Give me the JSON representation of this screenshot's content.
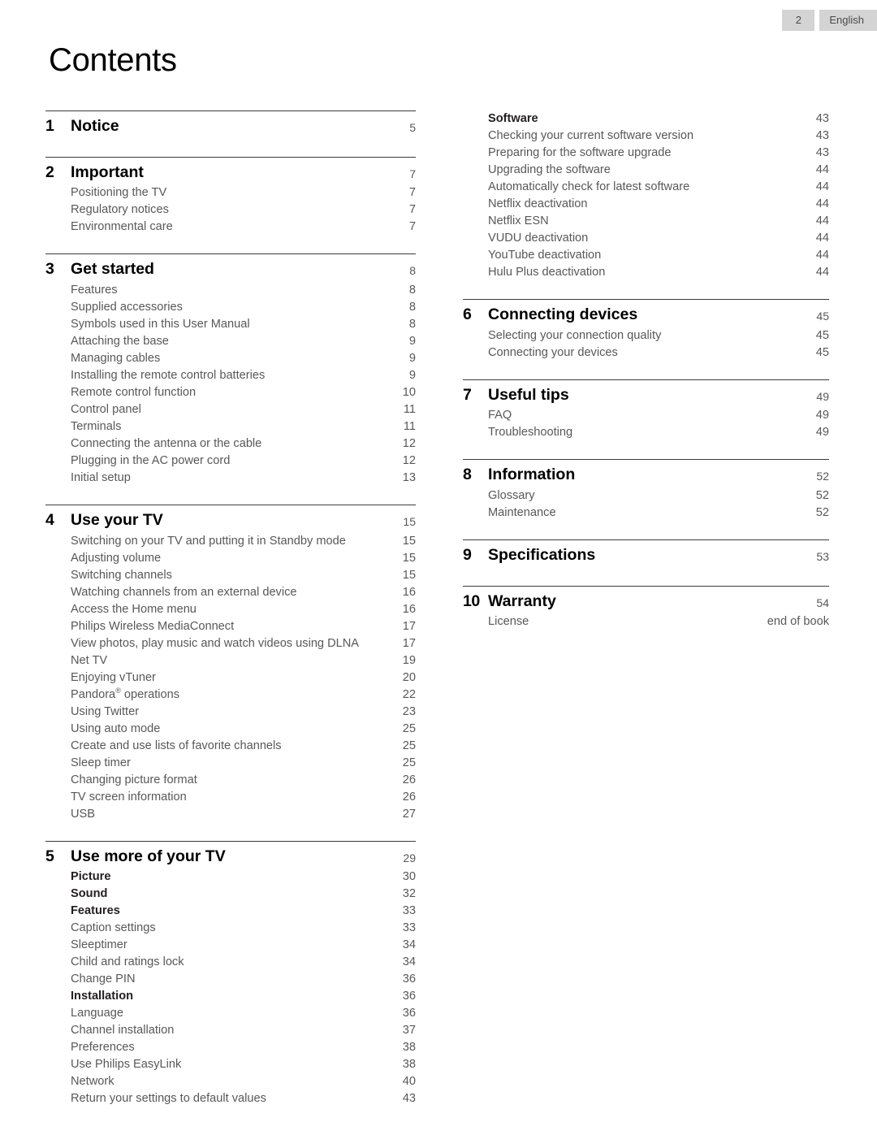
{
  "header": {
    "page_number": "2",
    "language": "English"
  },
  "title": "Contents",
  "columns": {
    "left": [
      {
        "number": "1",
        "label": "Notice",
        "page": "5",
        "items": []
      },
      {
        "number": "2",
        "label": "Important",
        "page": "7",
        "items": [
          {
            "label": "Positioning the TV",
            "page": "7",
            "bold": false
          },
          {
            "label": "Regulatory notices",
            "page": "7",
            "bold": false
          },
          {
            "label": "Environmental care",
            "page": "7",
            "bold": false
          }
        ]
      },
      {
        "number": "3",
        "label": "Get started",
        "page": "8",
        "items": [
          {
            "label": "Features",
            "page": "8",
            "bold": false
          },
          {
            "label": "Supplied accessories",
            "page": "8",
            "bold": false
          },
          {
            "label": "Symbols used in this User Manual",
            "page": "8",
            "bold": false
          },
          {
            "label": "Attaching the base",
            "page": "9",
            "bold": false
          },
          {
            "label": "Managing cables",
            "page": "9",
            "bold": false
          },
          {
            "label": "Installing the remote control batteries",
            "page": "9",
            "bold": false
          },
          {
            "label": "Remote control function",
            "page": "10",
            "bold": false
          },
          {
            "label": "Control panel",
            "page": "11",
            "bold": false
          },
          {
            "label": "Terminals",
            "page": "11",
            "bold": false
          },
          {
            "label": "Connecting the antenna or the cable",
            "page": "12",
            "bold": false
          },
          {
            "label": "Plugging in the AC power cord",
            "page": "12",
            "bold": false
          },
          {
            "label": "Initial setup",
            "page": "13",
            "bold": false
          }
        ]
      },
      {
        "number": "4",
        "label": "Use your TV",
        "page": "15",
        "items": [
          {
            "label": "Switching on your TV and putting it in Standby mode",
            "page": "15",
            "bold": false
          },
          {
            "label": "Adjusting volume",
            "page": "15",
            "bold": false
          },
          {
            "label": "Switching channels",
            "page": "15",
            "bold": false
          },
          {
            "label": "Watching channels from an external device",
            "page": "16",
            "bold": false
          },
          {
            "label": "Access the Home menu",
            "page": "16",
            "bold": false
          },
          {
            "label": "Philips Wireless MediaConnect",
            "page": "17",
            "bold": false
          },
          {
            "label": "View photos, play music and watch videos using DLNA",
            "page": "17",
            "bold": false
          },
          {
            "label": "Net TV",
            "page": "19",
            "bold": false
          },
          {
            "label": "Enjoying vTuner",
            "page": "20",
            "bold": false
          },
          {
            "label": "Pandora® operations",
            "page": "22",
            "bold": false,
            "sup": "®"
          },
          {
            "label": "Using Twitter",
            "page": "23",
            "bold": false
          },
          {
            "label": "Using auto mode",
            "page": "25",
            "bold": false
          },
          {
            "label": "Create and use lists of favorite channels",
            "page": "25",
            "bold": false
          },
          {
            "label": "Sleep timer",
            "page": "25",
            "bold": false
          },
          {
            "label": "Changing picture format",
            "page": "26",
            "bold": false
          },
          {
            "label": "TV screen information",
            "page": "26",
            "bold": false
          },
          {
            "label": "USB",
            "page": "27",
            "bold": false
          }
        ]
      },
      {
        "number": "5",
        "label": "Use more of your TV",
        "page": "29",
        "items": [
          {
            "label": "Picture",
            "page": "30",
            "bold": true
          },
          {
            "label": "Sound",
            "page": "32",
            "bold": true
          },
          {
            "label": "Features",
            "page": "33",
            "bold": true
          },
          {
            "label": "Caption settings",
            "page": "33",
            "bold": false
          },
          {
            "label": "Sleeptimer",
            "page": "34",
            "bold": false
          },
          {
            "label": "Child and ratings lock",
            "page": "34",
            "bold": false
          },
          {
            "label": "Change PIN",
            "page": "36",
            "bold": false
          },
          {
            "label": "Installation",
            "page": "36",
            "bold": true
          },
          {
            "label": "Language",
            "page": "36",
            "bold": false
          },
          {
            "label": "Channel installation",
            "page": "37",
            "bold": false
          },
          {
            "label": "Preferences",
            "page": "38",
            "bold": false
          },
          {
            "label": "Use Philips EasyLink",
            "page": "38",
            "bold": false
          },
          {
            "label": "Network",
            "page": "40",
            "bold": false
          },
          {
            "label": "Return your settings to default values",
            "page": "43",
            "bold": false
          }
        ]
      }
    ],
    "right_continued": [
      {
        "label": "Software",
        "page": "43",
        "bold": true
      },
      {
        "label": "Checking your current software version",
        "page": "43",
        "bold": false
      },
      {
        "label": "Preparing for the software upgrade",
        "page": "43",
        "bold": false
      },
      {
        "label": "Upgrading the software",
        "page": "44",
        "bold": false
      },
      {
        "label": "Automatically check for latest software",
        "page": "44",
        "bold": false
      },
      {
        "label": "Netflix deactivation",
        "page": "44",
        "bold": false
      },
      {
        "label": "Netflix ESN",
        "page": "44",
        "bold": false
      },
      {
        "label": "VUDU deactivation",
        "page": "44",
        "bold": false
      },
      {
        "label": "YouTube deactivation",
        "page": "44",
        "bold": false
      },
      {
        "label": "Hulu Plus deactivation",
        "page": "44",
        "bold": false
      }
    ],
    "right": [
      {
        "number": "6",
        "label": "Connecting devices",
        "page": "45",
        "items": [
          {
            "label": "Selecting your connection quality",
            "page": "45",
            "bold": false
          },
          {
            "label": "Connecting your devices",
            "page": "45",
            "bold": false
          }
        ]
      },
      {
        "number": "7",
        "label": "Useful tips",
        "page": "49",
        "items": [
          {
            "label": "FAQ",
            "page": "49",
            "bold": false
          },
          {
            "label": "Troubleshooting",
            "page": "49",
            "bold": false
          }
        ]
      },
      {
        "number": "8",
        "label": "Information",
        "page": "52",
        "items": [
          {
            "label": "Glossary",
            "page": "52",
            "bold": false
          },
          {
            "label": "Maintenance",
            "page": "52",
            "bold": false
          }
        ]
      },
      {
        "number": "9",
        "label": "Specifications",
        "page": "53",
        "items": []
      },
      {
        "number": "10",
        "label": "Warranty",
        "page": "54",
        "items": [
          {
            "label": "License",
            "page": "end of book",
            "bold": false
          }
        ]
      }
    ]
  }
}
